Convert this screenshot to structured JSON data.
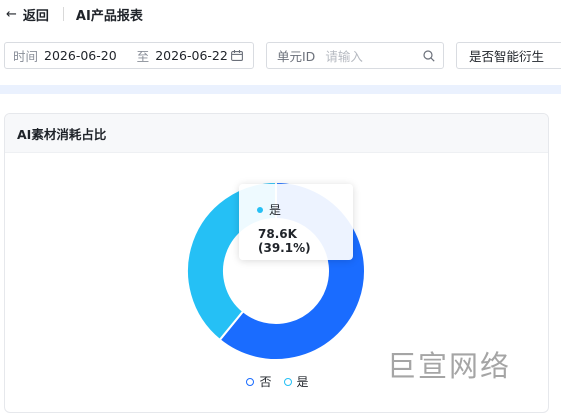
{
  "header": {
    "back_label": "返回",
    "page_title": "AI产品报表"
  },
  "filters": {
    "date_range": {
      "label": "时间",
      "start": "2026-06-20",
      "separator": "至",
      "end": "2026-06-22",
      "icon": "calendar-icon"
    },
    "unit_id": {
      "label": "单元ID",
      "placeholder": "请输入",
      "icon": "search-icon"
    },
    "derivative": {
      "value": "是否智能衍生"
    }
  },
  "card": {
    "title": "AI素材消耗占比"
  },
  "chart_data": {
    "type": "pie",
    "title": "AI素材消耗占比",
    "series": [
      {
        "name": "否",
        "value": 0.609,
        "color": "#1a6cff"
      },
      {
        "name": "是",
        "value": 0.391,
        "color": "#25c0f5"
      }
    ],
    "legend": {
      "placement": "bottom-center",
      "items": [
        "否",
        "是"
      ]
    },
    "tooltip": {
      "name": "是",
      "value_text": "78.6K (39.1%)"
    }
  },
  "watermark": "巨宣网络"
}
